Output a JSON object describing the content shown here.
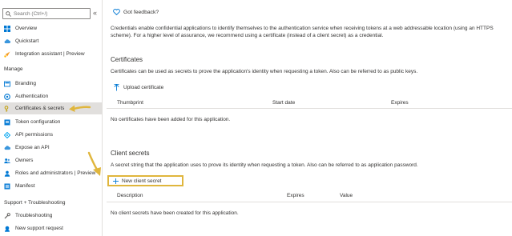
{
  "sidebar": {
    "search_placeholder": "Search (Ctrl+/)",
    "collapse_glyph": "«",
    "items_top": [
      {
        "label": "Overview",
        "icon": "grid-icon"
      },
      {
        "label": "Quickstart",
        "icon": "cloud-icon"
      },
      {
        "label": "Integration assistant | Preview",
        "icon": "rocket-icon"
      }
    ],
    "manage_heading": "Manage",
    "manage_items": [
      {
        "label": "Branding",
        "icon": "branding-icon"
      },
      {
        "label": "Authentication",
        "icon": "authentication-icon"
      },
      {
        "label": "Certificates & secrets",
        "icon": "key-icon",
        "selected": true
      },
      {
        "label": "Token configuration",
        "icon": "token-icon"
      },
      {
        "label": "API permissions",
        "icon": "api-permissions-icon"
      },
      {
        "label": "Expose an API",
        "icon": "cloud-icon"
      },
      {
        "label": "Owners",
        "icon": "owners-icon"
      },
      {
        "label": "Roles and administrators | Preview",
        "icon": "roles-icon"
      },
      {
        "label": "Manifest",
        "icon": "manifest-icon"
      }
    ],
    "support_heading": "Support + Troubleshooting",
    "support_items": [
      {
        "label": "Troubleshooting",
        "icon": "wrench-icon"
      },
      {
        "label": "New support request",
        "icon": "support-request-icon"
      }
    ]
  },
  "main": {
    "feedback_label": "Got feedback?",
    "intro_text": "Credentials enable confidential applications to identify themselves to the authentication service when receiving tokens at a web addressable location (using an HTTPS scheme). For a higher level of assurance, we recommend using a certificate (instead of a client secret) as a credential.",
    "certificates": {
      "heading": "Certificates",
      "description": "Certificates can be used as secrets to prove the application's identity when requesting a token. Also can be referred to as public keys.",
      "upload_label": "Upload certificate",
      "columns": [
        "Thumbprint",
        "Start date",
        "Expires"
      ],
      "empty_text": "No certificates have been added for this application."
    },
    "client_secrets": {
      "heading": "Client secrets",
      "description": "A secret string that the application uses to prove its identity when requesting a token. Also can be referred to as application password.",
      "new_label": "New client secret",
      "columns": [
        "Description",
        "Expires",
        "Value"
      ],
      "empty_text": "No client secrets have been created for this application."
    }
  },
  "colors": {
    "highlight": "#e0b63d",
    "accent_blue": "#0078d4",
    "selected_bg": "#e1dfdd"
  }
}
